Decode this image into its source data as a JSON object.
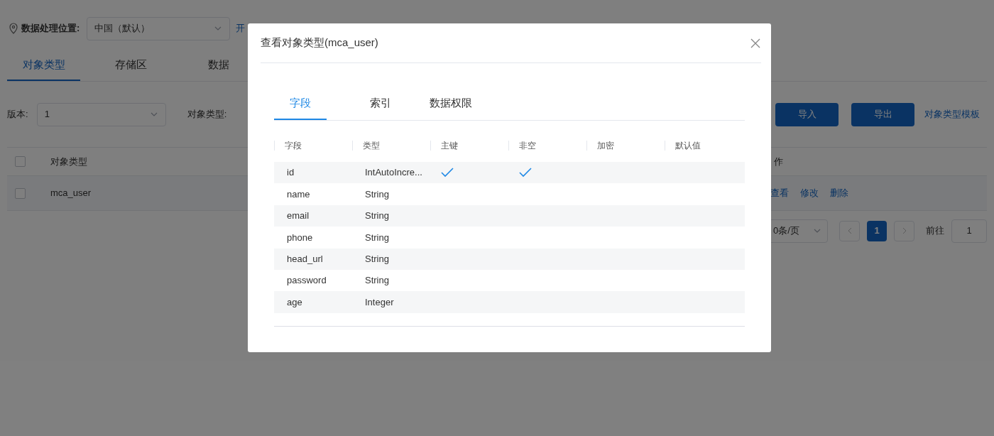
{
  "location": {
    "label": "数据处理位置:",
    "value": "中国（默认）",
    "link": "开"
  },
  "tabs": [
    {
      "label": "对象类型",
      "selected": true
    },
    {
      "label": "存储区",
      "selected": false
    },
    {
      "label": "数据",
      "selected": false
    }
  ],
  "filters": {
    "version_label": "版本:",
    "version_value": "1",
    "type_label": "对象类型:"
  },
  "buttons": [
    "导入",
    "导出"
  ],
  "template_link": "对象类型模板",
  "table": {
    "header_checked": false,
    "columns": [
      "对象类型",
      "作"
    ],
    "rows": [
      {
        "name": "mca_user",
        "checked": false,
        "actions": [
          "查看",
          "修改",
          "删除"
        ]
      }
    ]
  },
  "pagination": {
    "page_size": "0条/页",
    "pages": [
      {
        "label": "1",
        "selected": true
      }
    ],
    "goto_label": "前往",
    "goto_value": "1"
  },
  "modal": {
    "title": "查看对象类型(mca_user)",
    "tabs": [
      {
        "label": "字段",
        "selected": true
      },
      {
        "label": "索引",
        "selected": false
      },
      {
        "label": "数据权限",
        "selected": false
      }
    ],
    "columns": [
      "字段",
      "类型",
      "主键",
      "非空",
      "加密",
      "默认值"
    ],
    "rows": [
      {
        "field": "id",
        "type": "IntAutoIncre...",
        "primary_key": true,
        "not_null": true
      },
      {
        "field": "name",
        "type": "String",
        "primary_key": false,
        "not_null": false
      },
      {
        "field": "email",
        "type": "String",
        "primary_key": false,
        "not_null": false
      },
      {
        "field": "phone",
        "type": "String",
        "primary_key": false,
        "not_null": false
      },
      {
        "field": "head_url",
        "type": "String",
        "primary_key": false,
        "not_null": false
      },
      {
        "field": "password",
        "type": "String",
        "primary_key": false,
        "not_null": false
      },
      {
        "field": "age",
        "type": "Integer",
        "primary_key": false,
        "not_null": false
      }
    ]
  }
}
